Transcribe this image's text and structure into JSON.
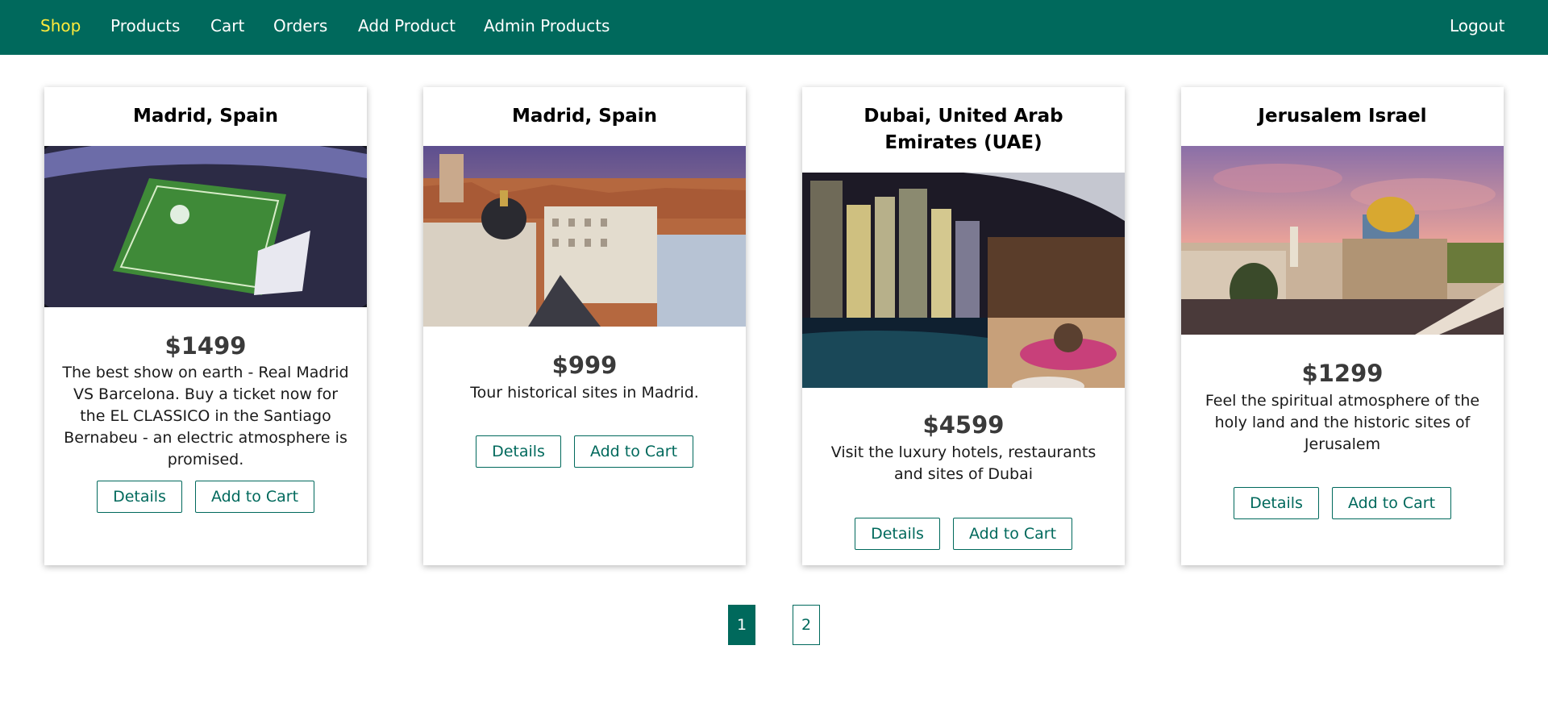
{
  "nav": {
    "shop": "Shop",
    "products": "Products",
    "cart": "Cart",
    "orders": "Orders",
    "add_product": "Add Product",
    "admin_products": "Admin Products",
    "logout": "Logout"
  },
  "products": [
    {
      "title": "Madrid, Spain",
      "price": "$1499",
      "description": "The best show on earth - Real Madrid VS Barcelona. Buy a ticket now for the EL CLASSICO in the Santiago Bernabeu - an electric atmosphere is promised.",
      "details_label": "Details",
      "add_to_cart_label": "Add to Cart"
    },
    {
      "title": "Madrid, Spain",
      "price": "$999",
      "description": "Tour historical sites in Madrid.",
      "details_label": "Details",
      "add_to_cart_label": "Add to Cart"
    },
    {
      "title": "Dubai, United Arab Emirates (UAE)",
      "price": "$4599",
      "description": "Visit the luxury hotels, restaurants and sites of Dubai",
      "details_label": "Details",
      "add_to_cart_label": "Add to Cart"
    },
    {
      "title": "Jerusalem Israel",
      "price": "$1299",
      "description": "Feel the spiritual atmosphere of the holy land and the historic sites of Jerusalem",
      "details_label": "Details",
      "add_to_cart_label": "Add to Cart"
    }
  ],
  "pagination": {
    "current": "1",
    "next": "2"
  },
  "colors": {
    "primary": "#00695c",
    "active_nav": "#ffeb3b"
  }
}
